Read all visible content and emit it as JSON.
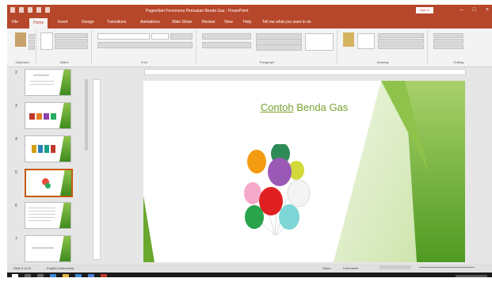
{
  "window": {
    "title": "Pages/dari Fenomena Pemuaian Benda Gas - PowerPoint",
    "sign_in": "Sign in",
    "controls": [
      "–",
      "□",
      "×"
    ]
  },
  "ribbon_tabs": [
    "File",
    "Home",
    "Insert",
    "Design",
    "Transitions",
    "Animations",
    "Slide Show",
    "Review",
    "View",
    "Help",
    "Tell me what you want to do"
  ],
  "ribbon_groups": [
    "Clipboard",
    "Slides",
    "Font",
    "Paragraph",
    "Drawing",
    "Editing"
  ],
  "thumbnails": [
    {
      "num": "2"
    },
    {
      "num": "3"
    },
    {
      "num": "4"
    },
    {
      "num": "5"
    },
    {
      "num": "6"
    },
    {
      "num": "7"
    }
  ],
  "slide": {
    "title_underlined": "Contoh",
    "title_rest": " Benda Gas"
  },
  "status": {
    "slide_info": "Slide 5 of 10",
    "language": "English (Indonesia)",
    "notes": "Notes",
    "comments": "Comments"
  },
  "colors": {
    "accent": "#b7472a",
    "slide_green": "#78a22f"
  },
  "icons": [
    "powerpoint-icon",
    "save-icon",
    "undo-icon",
    "redo-icon",
    "start-icon",
    "search-icon",
    "task-view-icon",
    "edge-icon",
    "explorer-icon",
    "store-icon",
    "mail-icon",
    "powerpoint-taskbar-icon"
  ]
}
